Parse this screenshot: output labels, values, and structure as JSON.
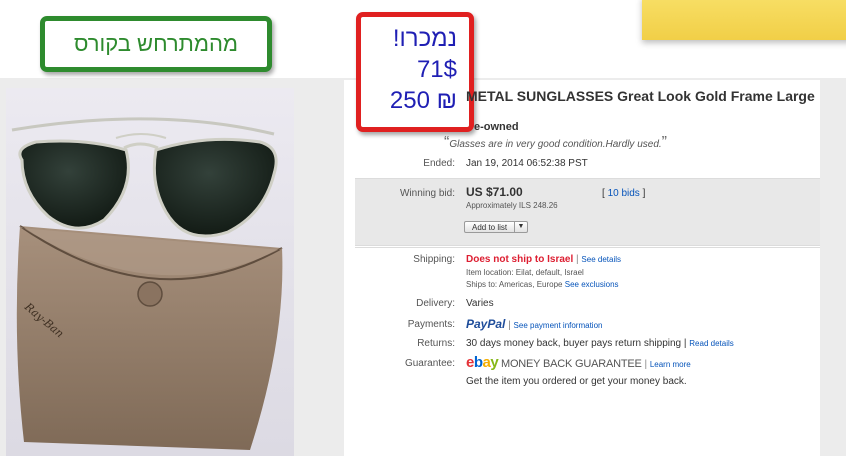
{
  "callouts": {
    "course_label": "מהמתרחש בקורס",
    "sold_label": "נמכרו!",
    "price_usd": "71$",
    "price_ils": "250 ₪"
  },
  "listing": {
    "title": "METAL SUNGLASSES Great Look Gold Frame Large",
    "condition": "e-owned",
    "seller_note": "Glasses are in very good condition.Hardly used.",
    "ended_label": "Ended:",
    "ended_value": "Jan 19, 2014 06:52:38 PST",
    "winning_bid_label": "Winning bid:",
    "winning_bid_value": "US $71.00",
    "approx_value": "Approximately ILS 248.26",
    "bids_link": "10 bids",
    "add_to_list": "Add to list",
    "shipping_label": "Shipping:",
    "shipping_value": "Does not ship to Israel",
    "see_details": "See details",
    "item_location": "Item location:  Eilat, default, Israel",
    "ships_to": "Ships to:  Americas, Europe",
    "see_exclusions": "See exclusions",
    "delivery_label": "Delivery:",
    "delivery_value": "Varies",
    "payments_label": "Payments:",
    "paypal": "PayPal",
    "payment_info": "See payment information",
    "returns_label": "Returns:",
    "returns_value": "30 days money back, buyer pays return shipping |",
    "read_details": "Read details",
    "guarantee_label": "Guarantee:",
    "ebay_logo": "ebay",
    "money_back": "MONEY BACK GUARANTEE",
    "learn_more": "Learn more",
    "guarantee_note": "Get the item you ordered or get your money back."
  },
  "photo": {
    "case_brand": "Ray-Ban"
  },
  "colors": {
    "callout_green": "#2e8b2e",
    "callout_red": "#e02020",
    "callout_text_blue": "#1f1fb4",
    "link_blue": "#0654ba",
    "warning_red": "#dd1e31",
    "sticky_yellow": "#f5d957"
  }
}
